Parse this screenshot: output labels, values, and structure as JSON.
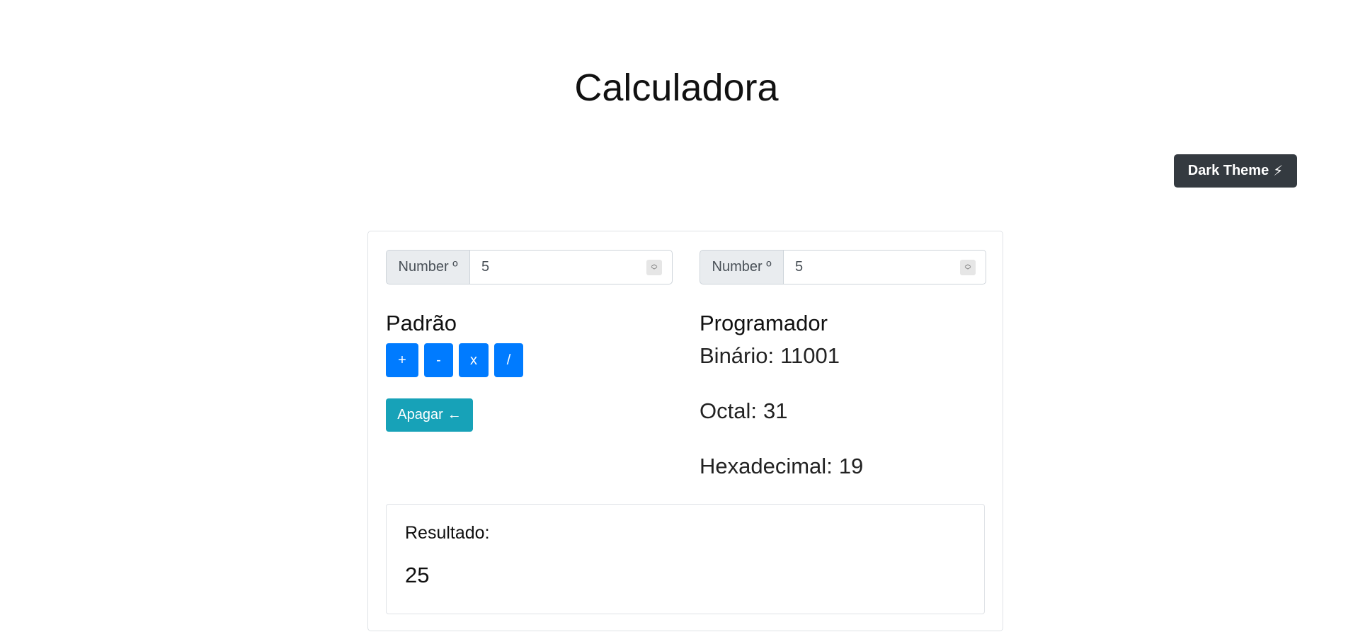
{
  "page": {
    "title": "Calculadora"
  },
  "theme_button": {
    "label": "Dark Theme",
    "icon": "lightning-bolt-icon",
    "icon_glyph": "⚡"
  },
  "inputs": [
    {
      "prefix": "Number º",
      "value": "5"
    },
    {
      "prefix": "Number º",
      "value": "5"
    }
  ],
  "standard": {
    "title": "Padrão",
    "operations": [
      "+",
      "-",
      "x",
      "/"
    ],
    "clear_label": "Apagar",
    "clear_icon": "arrow-left-icon",
    "clear_glyph": "←"
  },
  "programmer": {
    "title": "Programador",
    "binary_label": "Binário:",
    "binary_value": "11001",
    "octal_label": "Octal:",
    "octal_value": "31",
    "hex_label": "Hexadecimal:",
    "hex_value": "19"
  },
  "result": {
    "label": "Resultado:",
    "value": "25"
  },
  "colors": {
    "primary": "#007bff",
    "info": "#17a2b8",
    "dark": "#343a40"
  }
}
